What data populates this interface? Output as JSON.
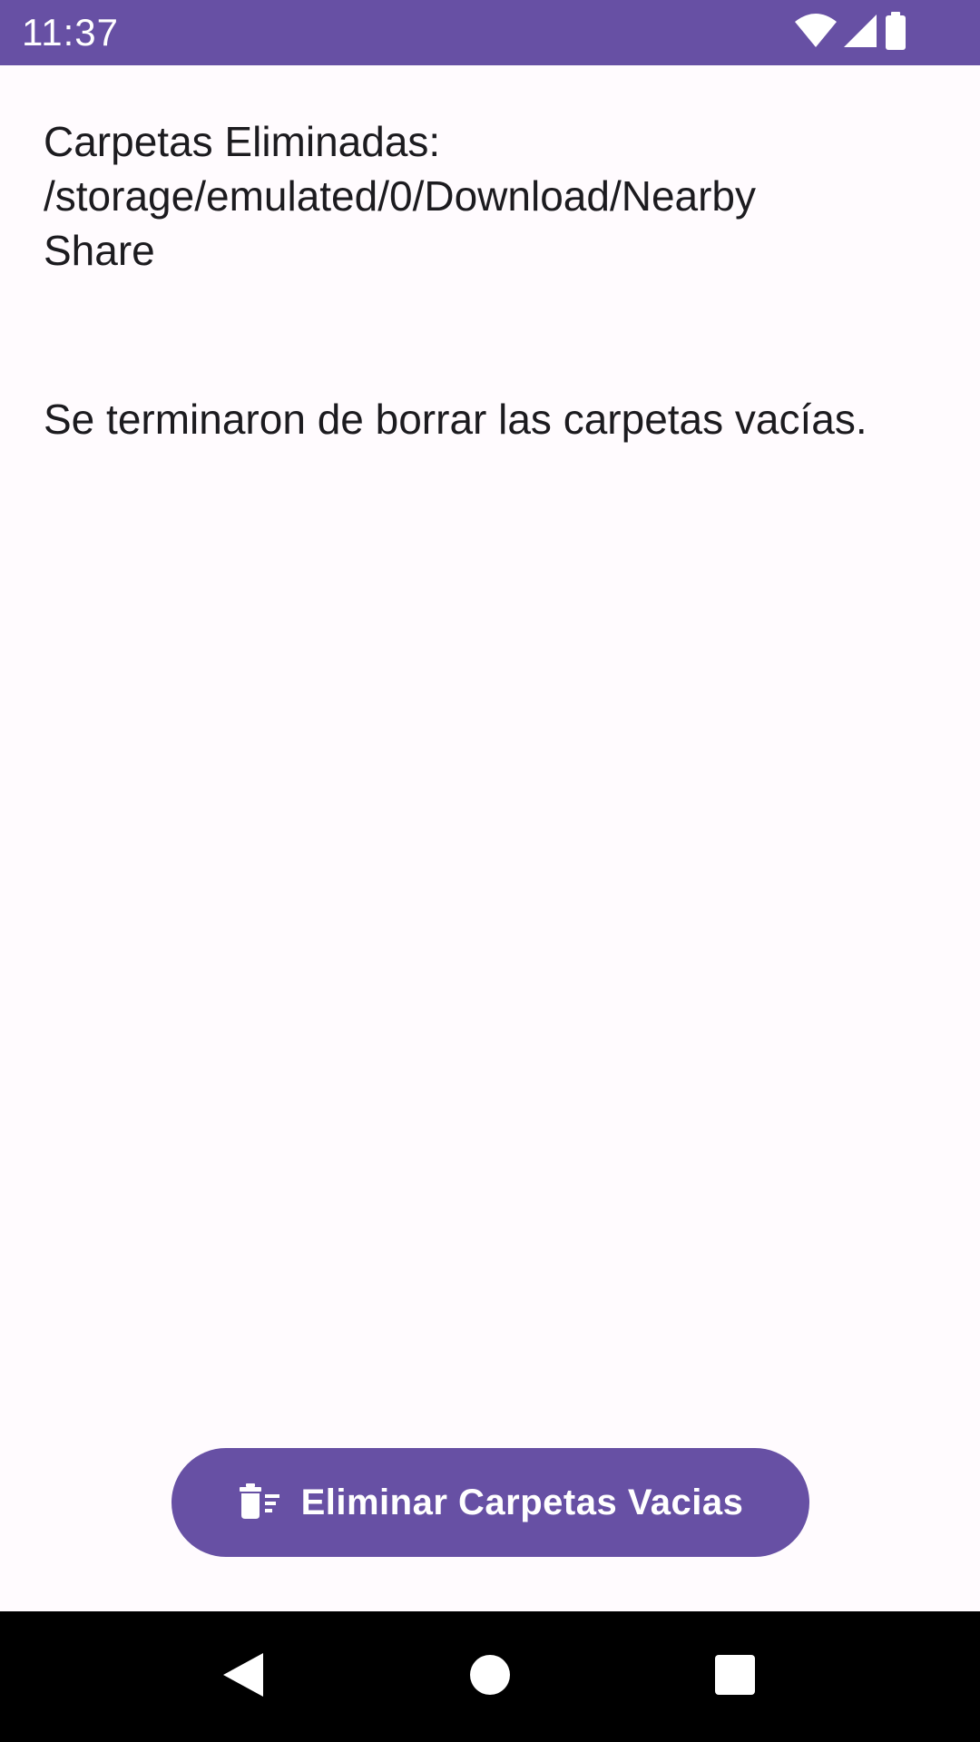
{
  "status_bar": {
    "time": "11:37",
    "background_color": "#6750a4",
    "icons": [
      "wifi-icon",
      "cellular-signal-icon",
      "battery-icon"
    ]
  },
  "main": {
    "result_text": "Carpetas Eliminadas:\n/storage/emulated/0/Download/Nearby\nShare",
    "done_text": "Se terminaron de borrar las carpetas vacías."
  },
  "action_button": {
    "label": "Eliminar Carpetas Vacias",
    "icon": "delete-sweep-icon",
    "background_color": "#6750a4"
  },
  "navigation_bar": {
    "buttons": [
      "back-icon",
      "home-icon",
      "recents-icon"
    ]
  }
}
